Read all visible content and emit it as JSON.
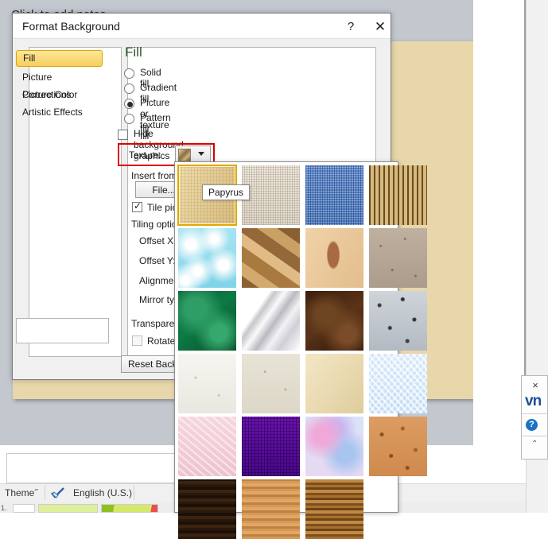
{
  "app": {
    "notes_placeholder": "Click to add notes",
    "status": {
      "theme": "Theme˝",
      "spell_icon": "spellcheck-icon",
      "language": "English (U.S.)",
      "slide_number": "1."
    },
    "right_popup": {
      "close": "×",
      "brand": "vn",
      "help": "?",
      "scroll_up": "⌃"
    }
  },
  "dialog": {
    "title": "Format Background",
    "help_button": "?",
    "close_button": "✕",
    "nav": {
      "items": [
        {
          "label": "Fill",
          "selected": true
        },
        {
          "label": "Picture Corrections",
          "selected": false
        },
        {
          "label": "Picture Color",
          "selected": false
        },
        {
          "label": "Artistic Effects",
          "selected": false
        }
      ]
    },
    "content": {
      "heading": "Fill",
      "options": [
        {
          "label": "Solid fill",
          "type": "radio",
          "checked": false
        },
        {
          "label": "Gradient fill",
          "type": "radio",
          "checked": false
        },
        {
          "label": "Picture or texture fill",
          "type": "radio",
          "checked": true
        },
        {
          "label": "Pattern fill",
          "type": "radio",
          "checked": false
        },
        {
          "label": "Hide background graphics",
          "type": "checkbox",
          "checked": false
        }
      ],
      "texture_label": "Textᵤre:",
      "texture_caret": "▾",
      "fields": [
        {
          "label": "Insert from",
          "clipped": true
        },
        {
          "label": "Tile pict",
          "clipped": true
        },
        {
          "label": "Tiling optio",
          "clipped": true
        },
        {
          "label": "Offset X:",
          "clipped": true
        },
        {
          "label": "Offset Y:",
          "clipped": true
        },
        {
          "label": "Alignmen",
          "clipped": true
        },
        {
          "label": "Mirror typ",
          "clipped": true
        },
        {
          "label": "Transparen",
          "clipped": true
        },
        {
          "label": "Rotate",
          "clipped": true
        }
      ],
      "file_button": "File...",
      "reset_button": "Reset Backgr"
    }
  },
  "texture_gallery": {
    "tooltip": "Papyrus",
    "selected_index": 0,
    "columns": 4,
    "textures": [
      {
        "name": "Papyrus",
        "color": "#e8d6a2"
      },
      {
        "name": "Canvas",
        "color": "#e5ded0"
      },
      {
        "name": "Denim",
        "color": "#5a84c4"
      },
      {
        "name": "Woven mat",
        "color": "#c4a169"
      },
      {
        "name": "Water droplets",
        "color": "#9ee0ef"
      },
      {
        "name": "Paper bag",
        "color": "#b98d58"
      },
      {
        "name": "Fish fossil",
        "color": "#e8c79b"
      },
      {
        "name": "Sand",
        "color": "#b3a291"
      },
      {
        "name": "Green marble",
        "color": "#0c6b3c"
      },
      {
        "name": "White marble",
        "color": "#d9d9dc"
      },
      {
        "name": "Brown marble",
        "color": "#4a2a14"
      },
      {
        "name": "Granite",
        "color": "#b7bcc2"
      },
      {
        "name": "Newsprint",
        "color": "#f0eee8"
      },
      {
        "name": "Recycled paper",
        "color": "#e1ded0"
      },
      {
        "name": "Parchment",
        "color": "#eee0c0"
      },
      {
        "name": "Stationery",
        "color": "#ddeaf8"
      },
      {
        "name": "Pink tissue paper",
        "color": "#f3ccd5"
      },
      {
        "name": "Purple mesh",
        "color": "#5c0d9c"
      },
      {
        "name": "Bouquet",
        "color": "#dcd2ef"
      },
      {
        "name": "Cork",
        "color": "#d08d54"
      },
      {
        "name": "Walnut",
        "color": "#2e1c0e"
      },
      {
        "name": "Oak",
        "color": "#c98f4e"
      },
      {
        "name": "Medium wood",
        "color": "#9a6528"
      }
    ]
  }
}
